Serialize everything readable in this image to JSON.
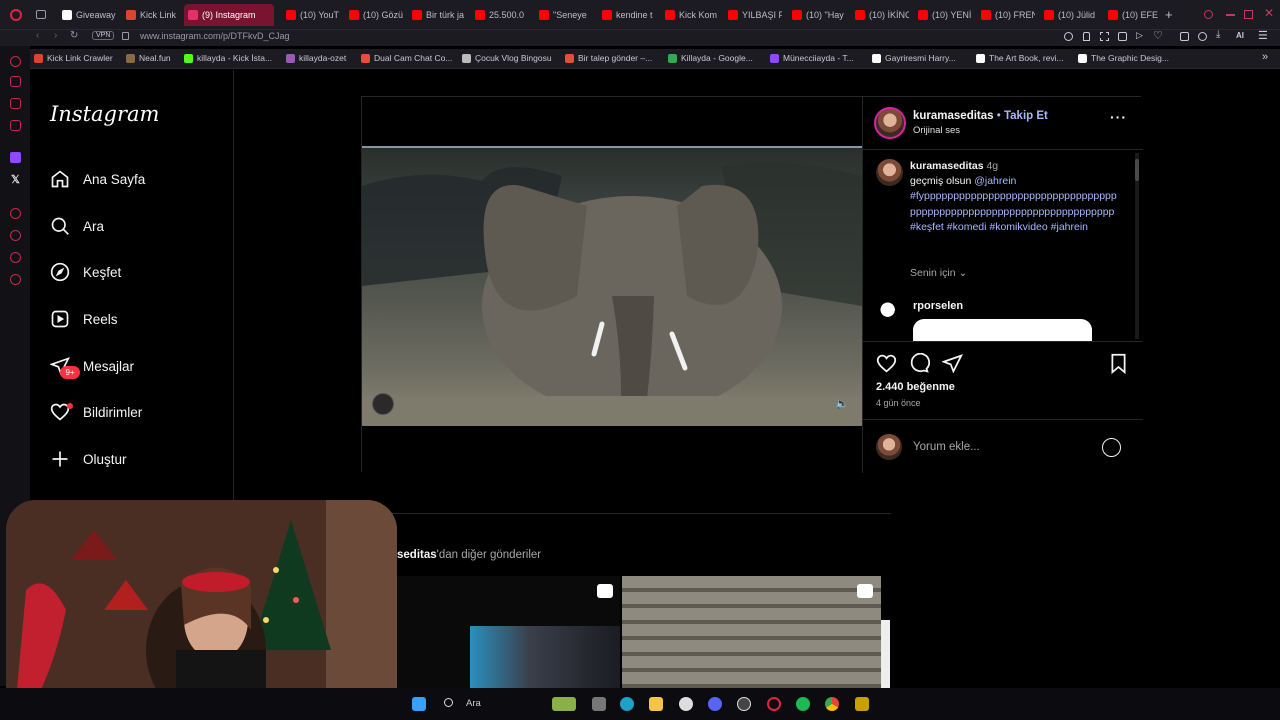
{
  "browser": {
    "tabs": [
      {
        "label": "Giveaway",
        "color": "#ffffff"
      },
      {
        "label": "Kick Link",
        "color": "#d9472b"
      },
      {
        "label": "(9) Instagram",
        "color": "#e1306c",
        "active": true
      },
      {
        "label": "(10) YouT",
        "color": "#ff0000"
      },
      {
        "label": "(10) Gözü",
        "color": "#ff0000"
      },
      {
        "label": "Bir türk ja",
        "color": "#ff0000"
      },
      {
        "label": "25.500.0",
        "color": "#ff0000"
      },
      {
        "label": "\"Seneye",
        "color": "#ff0000"
      },
      {
        "label": "kendine t",
        "color": "#ff0000"
      },
      {
        "label": "Kick Kom",
        "color": "#ff0000"
      },
      {
        "label": "YILBAŞI F",
        "color": "#ff0000"
      },
      {
        "label": "(10) \"Hay",
        "color": "#ff0000"
      },
      {
        "label": "(10) İKİNC",
        "color": "#ff0000"
      },
      {
        "label": "(10) YENİ",
        "color": "#ff0000"
      },
      {
        "label": "(10) FREN",
        "color": "#ff0000"
      },
      {
        "label": "(10) Jülid",
        "color": "#ff0000"
      },
      {
        "label": "(10) EFE S",
        "color": "#ff0000"
      }
    ],
    "new_tab": "+",
    "vpn": "VPN",
    "url": "www.instagram.com/p/DTFkvD_CJag",
    "ai_label": "AI",
    "bookmarks": [
      {
        "label": "Kick Link Crawler",
        "color": "#d9472b"
      },
      {
        "label": "Neal.fun",
        "color": "#8a6a40"
      },
      {
        "label": "killayda - Kick İsta...",
        "color": "#53fc18"
      },
      {
        "label": "killayda-ozet",
        "color": "#9b59b6"
      },
      {
        "label": "Dual Cam Chat Co...",
        "color": "#e74c3c"
      },
      {
        "label": "Çocuk Vlog Bingosu",
        "color": "#bbbbbb"
      },
      {
        "label": "Bir talep gönder –...",
        "color": "#e74c3c"
      },
      {
        "label": "Killayda - Google...",
        "color": "#34a853"
      },
      {
        "label": "Münecciiayda - T...",
        "color": "#9146ff"
      },
      {
        "label": "Gayriresmi Harry...",
        "color": "#ffffff"
      },
      {
        "label": "The Art Book, revi...",
        "color": "#ffffff"
      },
      {
        "label": "The Graphic Desig...",
        "color": "#ffffff"
      }
    ]
  },
  "sidebar": {
    "logo": "Instagram",
    "items": [
      {
        "label": "Ana Sayfa",
        "icon": "home-icon"
      },
      {
        "label": "Ara",
        "icon": "search-icon"
      },
      {
        "label": "Keşfet",
        "icon": "compass-icon"
      },
      {
        "label": "Reels",
        "icon": "reels-icon"
      },
      {
        "label": "Mesajlar",
        "icon": "messenger-icon"
      },
      {
        "label": "Bildirimler",
        "icon": "heart-icon"
      },
      {
        "label": "Oluştur",
        "icon": "plus-icon"
      }
    ],
    "messages_badge": "9+"
  },
  "post": {
    "author": "kuramaseditas",
    "separator": "•",
    "follow_label": "Takip Et",
    "audio": "Orijinal ses",
    "caption": {
      "author": "kuramaseditas",
      "age": "4g",
      "text": "geçmiş olsun",
      "mention": "@jahrein",
      "hashtags": "#fypppppppppppppppppppppppppppppppppppppppppppppppppppppppppppppppppppp #keşfet #komedi #komikvideo #jahrein"
    },
    "translation_toggle": "Senin için",
    "comment_user": "rporselen",
    "likes": "2.440 beğenme",
    "time": "4 gün önce",
    "comment_placeholder": "Yorum ekle..."
  },
  "more_posts": {
    "user_partial": "seditas",
    "suffix": "'dan diğer gönderiler"
  },
  "taskbar": {
    "search_label": "Ara"
  }
}
